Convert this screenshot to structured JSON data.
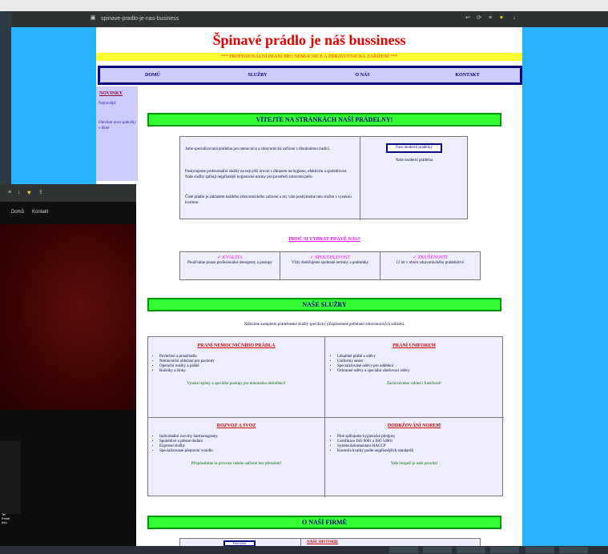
{
  "browser": {
    "url": "spinave-pradlo-je-nas-business"
  },
  "site": {
    "title": "Špinavé prádlo je náš bussiness",
    "subtitle": "*** PROFESIONÁLNÍ PRANÍ PRO NEMOCNICE A ZDRAVOTNICKÁ ZAŘÍZENÍ ***",
    "nav": [
      "DOMŮ",
      "SLUŽBY",
      "O NÁS",
      "KONTAKT"
    ],
    "sidebar": {
      "heading": "NOVINKY",
      "text": "Nejnovější",
      "link": "Otevření nové pobočky v Brně"
    },
    "welcome": {
      "heading": "VÍTEJTE NA STRÁNKÁCH NAŠÍ PRÁDELNY!",
      "p1": "Jsme specializovaná prádelna pro nemocnice a zdravotnická zařízení s dlouholetou tradicí.",
      "p2": "Poskytujeme profesionální služby na nejvyšší úrovni s důrazem na hygienu, efektivitu a spolehlivost. Naše služby splňují nejpřísnější hygienické normy pro prostředí zdravotní péče.",
      "p3": "Čisté prádlo je základem každého zdravotnického zařízení a my vám poskytneme tuto službu s vysokou kvalitou.",
      "photo_label": "Foto moderní prádelny",
      "photo_caption": "Naše moderní prádelna"
    },
    "why": {
      "heading": "PROČ SI VYBRAT PRÁVĚ NÁS?",
      "cols": [
        {
          "title": "✓ KVALITA",
          "text": "Používáme pouze profesionální detergenty a postupy"
        },
        {
          "title": "✓ SPOLEHLIVOST",
          "text": "Vždy dodržujeme sjednané termíny a podmínky"
        },
        {
          "title": "✓ ZKUŠENOSTI",
          "text": "15 let v oboru zdravotnického prádelnictví"
        }
      ]
    },
    "services": {
      "heading": "NAŠE SLUŽBY",
      "intro": "Nabízíme kompletní prádelenské služby specificky přizpůsobené potřebám zdravotnických zařízení.",
      "boxes": [
        {
          "title": "PRANÍ NEMOCNIČNÍHO PRÁDLA",
          "items": [
            "Povlečení a prostěradla",
            "Nemocniční oblečení pro pacienty",
            "Operační roušky a pláště",
            "Ručníky a žínky"
          ],
          "note": "Vysoké teploty a speciální postupy pro dokonalou dezinfekci!"
        },
        {
          "title": "PRANÍ UNIFOREM",
          "items": [
            "Lékařské pláště a oděvy",
            "Uniformy sester",
            "Specializované oděvy pro oddělení",
            "Ochranné oděvy a speciální ošetřovací oděvy"
          ],
          "note": "Zachováváme vzhled i funkčnost!"
        },
        {
          "title": "ROZVOZ A SVOZ",
          "items": [
            "Individuální rozvrhy harmonogramy",
            "Spolehlivé a přesné dodání",
            "Expresní služby",
            "Specializované přepravní vozidlo"
          ],
          "note": "Přizpůsobíme se provozu vašeho zařízení bez přerušení!"
        },
        {
          "title": "DODRŽOVÁNÍ NOREM",
          "items": [
            "Plně splňujeme hygienické předpisy",
            "Certifikace ISO 9001 a ISO 14001",
            "Systém dokumentace HACCP",
            "Kontrola kvality podle nejpřísnějších standardů"
          ],
          "note": "Vaše bezpečí je naše priorita!"
        }
      ]
    },
    "about": {
      "heading": "O NAŠÍ FIRMĚ",
      "photo_label": "Foto týmu",
      "history_title": "NAŠE HISTORIE"
    }
  },
  "front_window": {
    "nav": [
      "Domů",
      "Kontakt"
    ],
    "mini_text": [
      "Tel",
      "Email",
      "Info"
    ]
  },
  "colors": {
    "page_bg": "#29b3ff",
    "title_red": "#e60000",
    "nav_bg": "#ccccff",
    "banner_green": "#33ff33"
  }
}
